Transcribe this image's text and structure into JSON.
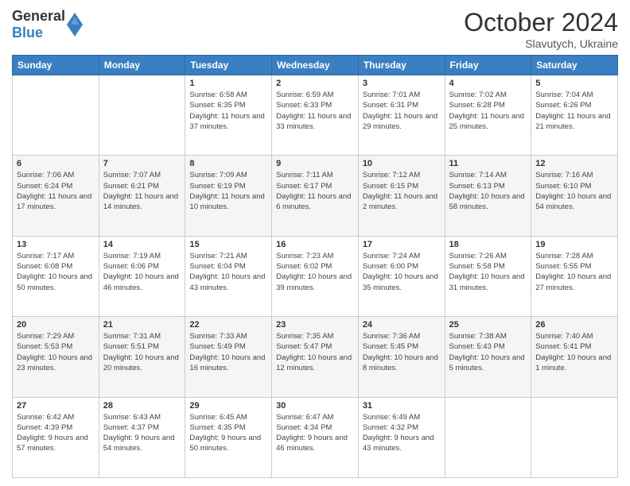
{
  "header": {
    "logo_general": "General",
    "logo_blue": "Blue",
    "month": "October 2024",
    "location": "Slavutych, Ukraine"
  },
  "days_of_week": [
    "Sunday",
    "Monday",
    "Tuesday",
    "Wednesday",
    "Thursday",
    "Friday",
    "Saturday"
  ],
  "weeks": [
    [
      {
        "day": "",
        "info": ""
      },
      {
        "day": "",
        "info": ""
      },
      {
        "day": "1",
        "info": "Sunrise: 6:58 AM\nSunset: 6:35 PM\nDaylight: 11 hours and 37 minutes."
      },
      {
        "day": "2",
        "info": "Sunrise: 6:59 AM\nSunset: 6:33 PM\nDaylight: 11 hours and 33 minutes."
      },
      {
        "day": "3",
        "info": "Sunrise: 7:01 AM\nSunset: 6:31 PM\nDaylight: 11 hours and 29 minutes."
      },
      {
        "day": "4",
        "info": "Sunrise: 7:02 AM\nSunset: 6:28 PM\nDaylight: 11 hours and 25 minutes."
      },
      {
        "day": "5",
        "info": "Sunrise: 7:04 AM\nSunset: 6:26 PM\nDaylight: 11 hours and 21 minutes."
      }
    ],
    [
      {
        "day": "6",
        "info": "Sunrise: 7:06 AM\nSunset: 6:24 PM\nDaylight: 11 hours and 17 minutes."
      },
      {
        "day": "7",
        "info": "Sunrise: 7:07 AM\nSunset: 6:21 PM\nDaylight: 11 hours and 14 minutes."
      },
      {
        "day": "8",
        "info": "Sunrise: 7:09 AM\nSunset: 6:19 PM\nDaylight: 11 hours and 10 minutes."
      },
      {
        "day": "9",
        "info": "Sunrise: 7:11 AM\nSunset: 6:17 PM\nDaylight: 11 hours and 6 minutes."
      },
      {
        "day": "10",
        "info": "Sunrise: 7:12 AM\nSunset: 6:15 PM\nDaylight: 11 hours and 2 minutes."
      },
      {
        "day": "11",
        "info": "Sunrise: 7:14 AM\nSunset: 6:13 PM\nDaylight: 10 hours and 58 minutes."
      },
      {
        "day": "12",
        "info": "Sunrise: 7:16 AM\nSunset: 6:10 PM\nDaylight: 10 hours and 54 minutes."
      }
    ],
    [
      {
        "day": "13",
        "info": "Sunrise: 7:17 AM\nSunset: 6:08 PM\nDaylight: 10 hours and 50 minutes."
      },
      {
        "day": "14",
        "info": "Sunrise: 7:19 AM\nSunset: 6:06 PM\nDaylight: 10 hours and 46 minutes."
      },
      {
        "day": "15",
        "info": "Sunrise: 7:21 AM\nSunset: 6:04 PM\nDaylight: 10 hours and 43 minutes."
      },
      {
        "day": "16",
        "info": "Sunrise: 7:23 AM\nSunset: 6:02 PM\nDaylight: 10 hours and 39 minutes."
      },
      {
        "day": "17",
        "info": "Sunrise: 7:24 AM\nSunset: 6:00 PM\nDaylight: 10 hours and 35 minutes."
      },
      {
        "day": "18",
        "info": "Sunrise: 7:26 AM\nSunset: 5:58 PM\nDaylight: 10 hours and 31 minutes."
      },
      {
        "day": "19",
        "info": "Sunrise: 7:28 AM\nSunset: 5:55 PM\nDaylight: 10 hours and 27 minutes."
      }
    ],
    [
      {
        "day": "20",
        "info": "Sunrise: 7:29 AM\nSunset: 5:53 PM\nDaylight: 10 hours and 23 minutes."
      },
      {
        "day": "21",
        "info": "Sunrise: 7:31 AM\nSunset: 5:51 PM\nDaylight: 10 hours and 20 minutes."
      },
      {
        "day": "22",
        "info": "Sunrise: 7:33 AM\nSunset: 5:49 PM\nDaylight: 10 hours and 16 minutes."
      },
      {
        "day": "23",
        "info": "Sunrise: 7:35 AM\nSunset: 5:47 PM\nDaylight: 10 hours and 12 minutes."
      },
      {
        "day": "24",
        "info": "Sunrise: 7:36 AM\nSunset: 5:45 PM\nDaylight: 10 hours and 8 minutes."
      },
      {
        "day": "25",
        "info": "Sunrise: 7:38 AM\nSunset: 5:43 PM\nDaylight: 10 hours and 5 minutes."
      },
      {
        "day": "26",
        "info": "Sunrise: 7:40 AM\nSunset: 5:41 PM\nDaylight: 10 hours and 1 minute."
      }
    ],
    [
      {
        "day": "27",
        "info": "Sunrise: 6:42 AM\nSunset: 4:39 PM\nDaylight: 9 hours and 57 minutes."
      },
      {
        "day": "28",
        "info": "Sunrise: 6:43 AM\nSunset: 4:37 PM\nDaylight: 9 hours and 54 minutes."
      },
      {
        "day": "29",
        "info": "Sunrise: 6:45 AM\nSunset: 4:35 PM\nDaylight: 9 hours and 50 minutes."
      },
      {
        "day": "30",
        "info": "Sunrise: 6:47 AM\nSunset: 4:34 PM\nDaylight: 9 hours and 46 minutes."
      },
      {
        "day": "31",
        "info": "Sunrise: 6:49 AM\nSunset: 4:32 PM\nDaylight: 9 hours and 43 minutes."
      },
      {
        "day": "",
        "info": ""
      },
      {
        "day": "",
        "info": ""
      }
    ]
  ]
}
